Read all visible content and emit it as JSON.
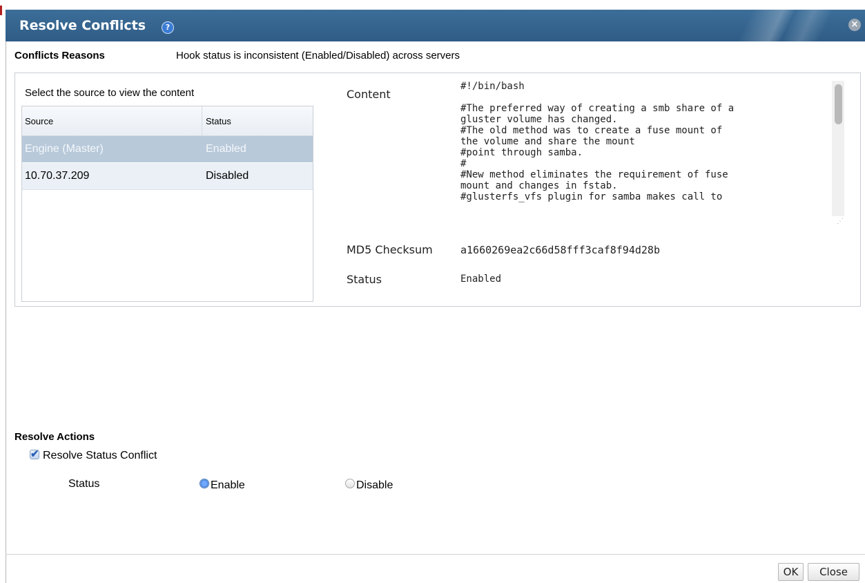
{
  "dialog": {
    "title": "Resolve Conflicts",
    "help_icon": "?",
    "close_icon": "×"
  },
  "reasons": {
    "label": "Conflicts Reasons",
    "text": "Hook status is inconsistent (Enabled/Disabled) across servers"
  },
  "source": {
    "caption": "Select the source to view the content",
    "columns": [
      "Source",
      "Status"
    ],
    "rows": [
      {
        "source": "Engine (Master)",
        "status": "Enabled",
        "selected": true
      },
      {
        "source": "10.70.37.209",
        "status": "Disabled",
        "selected": false
      }
    ]
  },
  "details": {
    "content_label": "Content",
    "content_text": "#!/bin/bash\n\n#The preferred way of creating a smb share of a\ngluster volume has changed.\n#The old method was to create a fuse mount of\nthe volume and share the mount\n#point through samba.\n#\n#New method eliminates the requirement of fuse\nmount and changes in fstab.\n#glusterfs_vfs plugin for samba makes call to",
    "checksum_label": "MD5 Checksum",
    "checksum_value": "a1660269ea2c66d58fff3caf8f94d28b",
    "status_label": "Status",
    "status_value": "Enabled"
  },
  "actions": {
    "label": "Resolve Actions",
    "checkbox_label": "Resolve Status Conflict",
    "checkbox_checked": true,
    "status_label": "Status",
    "options": [
      "Enable",
      "Disable"
    ],
    "selected": "Enable"
  },
  "footer": {
    "ok": "OK",
    "close": "Close"
  }
}
